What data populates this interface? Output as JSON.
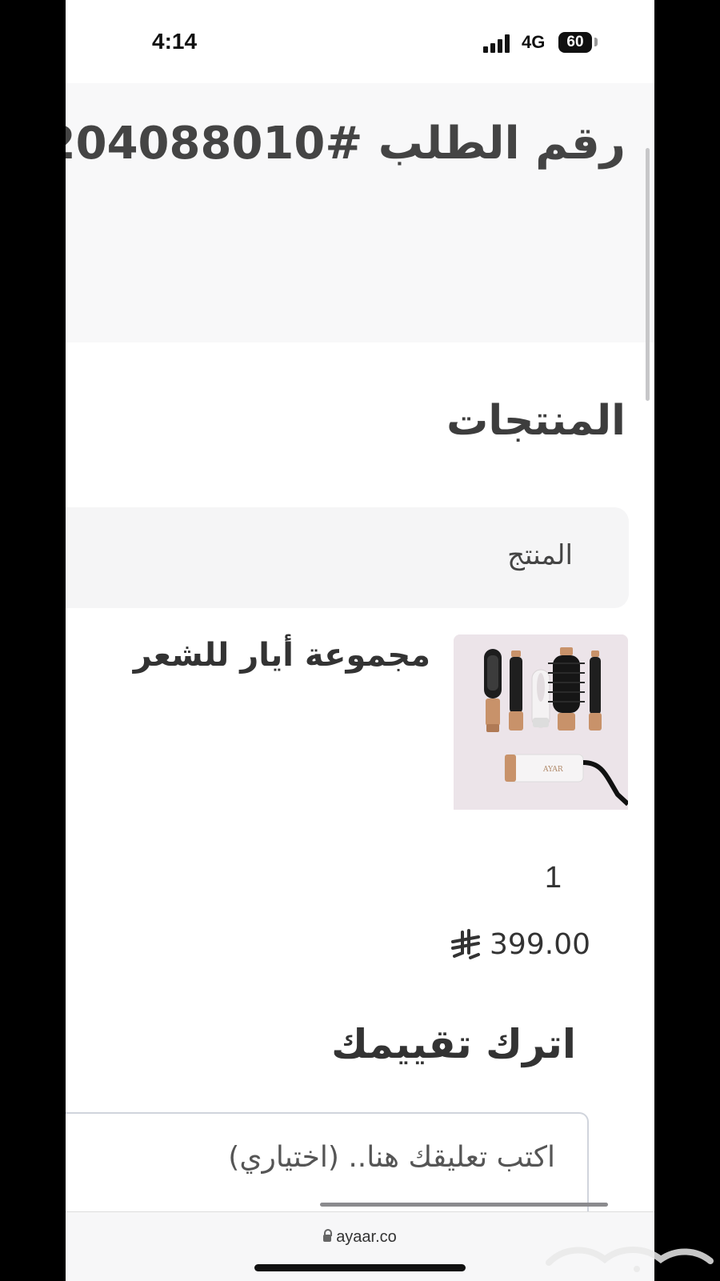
{
  "status_bar": {
    "time": "4:14",
    "network": "4G",
    "battery": "60"
  },
  "order": {
    "title_fragment": "رقم الطلب #204088010"
  },
  "products_section": {
    "title": "المنتجات",
    "column_header": "المنتج",
    "items": [
      {
        "name": "مجموعة أيار للشعر",
        "quantity": "1",
        "price": "399.00"
      }
    ]
  },
  "review": {
    "title": "اترك تقييمك",
    "placeholder": "اكتب تعليقك هنا.. (اختياري)"
  },
  "browser": {
    "url": "ayaar.co"
  },
  "product_image_text": "AYAR",
  "colors": {
    "accent_copper": "#c8926a",
    "background_grey": "#f8f8f9",
    "text": "#3a3a3a"
  }
}
